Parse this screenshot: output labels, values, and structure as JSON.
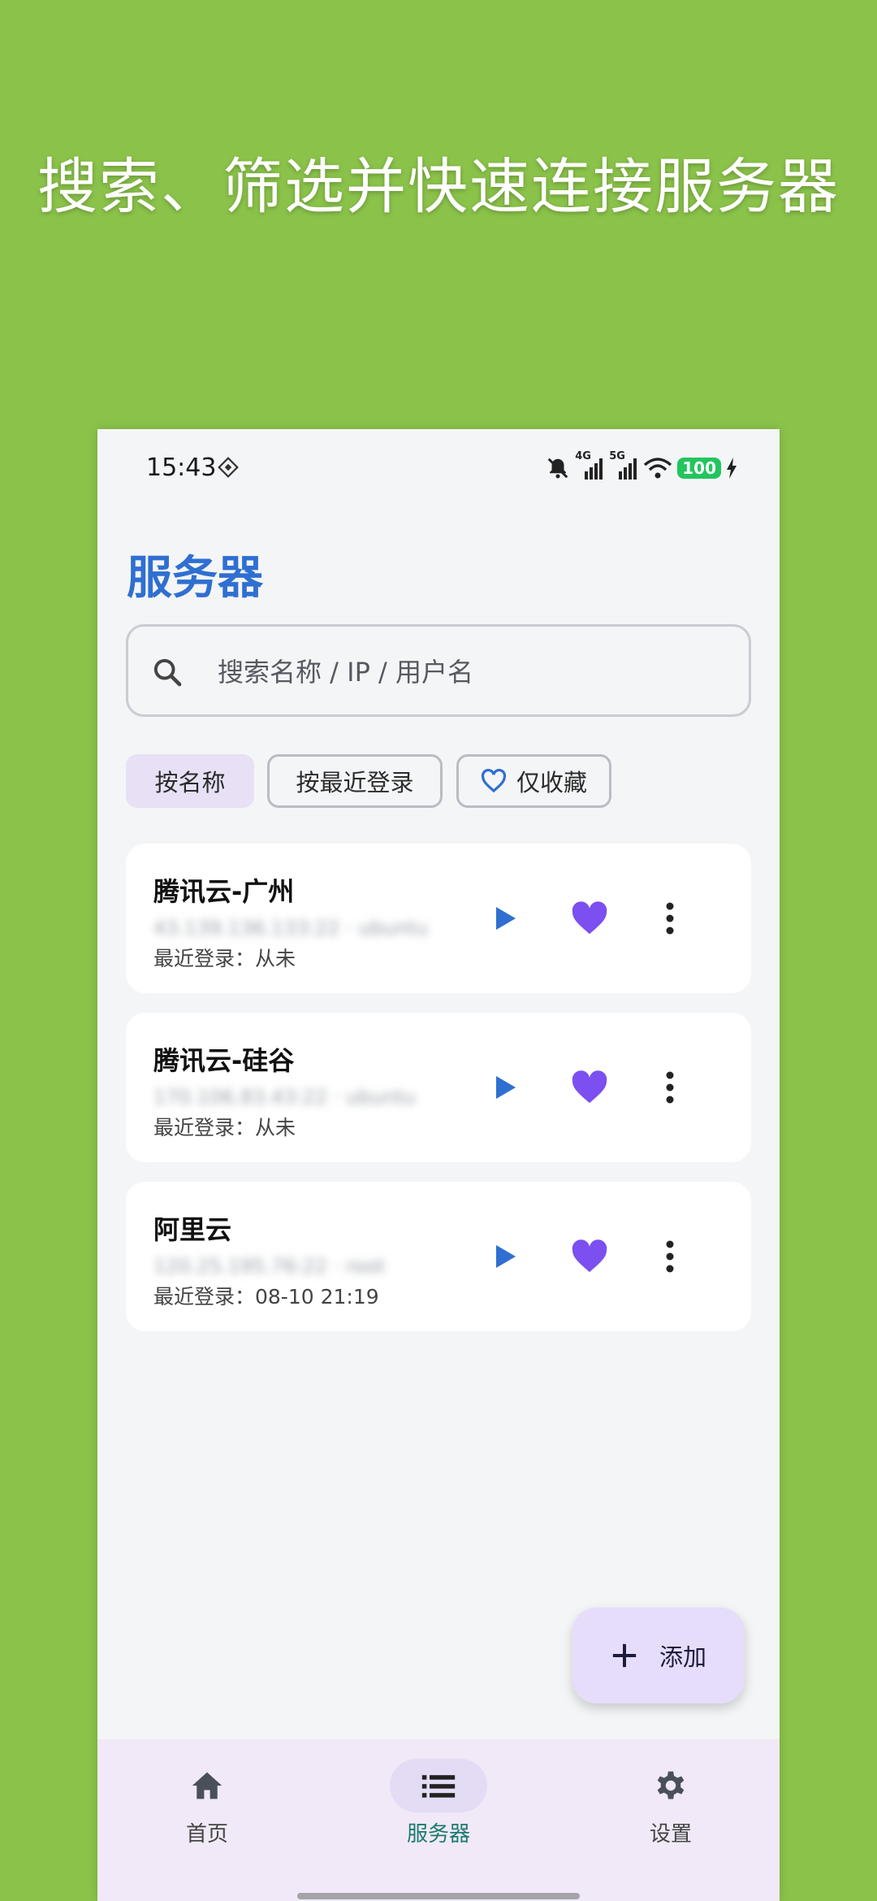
{
  "headline": "搜索、筛选并快速连接服务器",
  "status_bar": {
    "time": "15:43",
    "net1": "4G",
    "net2": "5G",
    "battery": "100"
  },
  "page": {
    "title": "服务器"
  },
  "search": {
    "placeholder": "搜索名称 / IP / 用户名",
    "value": ""
  },
  "filters": [
    {
      "label": "按名称",
      "selected": true
    },
    {
      "label": "按最近登录",
      "selected": false
    },
    {
      "label": "仅收藏",
      "selected": false,
      "icon": "heart-outline-icon"
    }
  ],
  "servers": [
    {
      "name": "腾讯云-广州",
      "address": "43.139.136.133:22 · ubuntu",
      "last_login": "最近登录：从未",
      "favorite": true
    },
    {
      "name": "腾讯云-硅谷",
      "address": "170.106.83.43:22 · ubuntu",
      "last_login": "最近登录：从未",
      "favorite": true
    },
    {
      "name": "阿里云",
      "address": "120.25.195.76:22 · root",
      "last_login": "最近登录：08-10 21:19",
      "favorite": true
    }
  ],
  "fab": {
    "label": "添加"
  },
  "nav": [
    {
      "label": "首页",
      "icon": "home-icon",
      "active": false
    },
    {
      "label": "服务器",
      "icon": "list-icon",
      "active": true
    },
    {
      "label": "设置",
      "icon": "gear-icon",
      "active": false
    }
  ],
  "colors": {
    "background": "#8bc34a",
    "accent_blue": "#2f6fd1",
    "heart_purple": "#7b4ff0",
    "play_blue": "#2f6fd1",
    "nav_active_text": "#1a7a6f"
  }
}
